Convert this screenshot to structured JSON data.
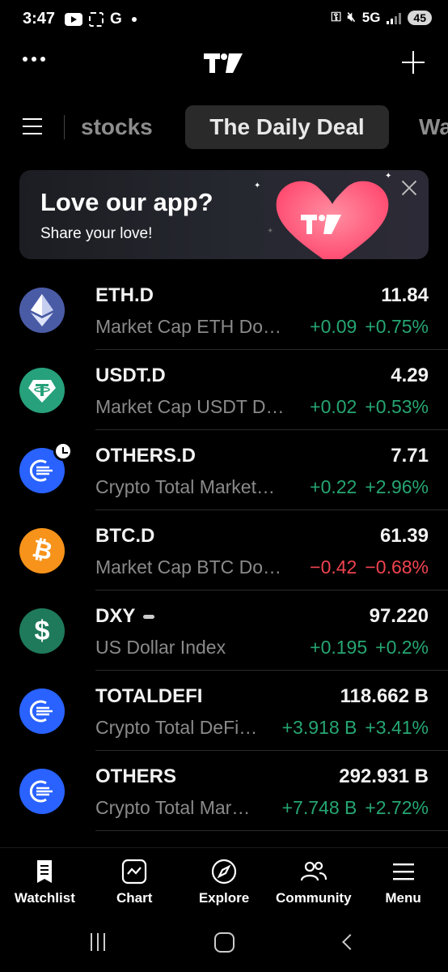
{
  "status_bar": {
    "time": "3:47",
    "g_label": "G",
    "network": "5G",
    "battery": "45"
  },
  "tabs": [
    {
      "label": "stocks"
    },
    {
      "label": "The Daily Deal"
    },
    {
      "label": "Wa"
    }
  ],
  "banner": {
    "title": "Love our app?",
    "subtitle": "Share your love!"
  },
  "watchlist": [
    {
      "symbol": "ETH.D",
      "description": "Market Cap ETH Do…",
      "price": "11.84",
      "change": "+0.09",
      "change_pct": "+0.75%",
      "direction": "up",
      "icon": "ethereum-icon",
      "icon_color": "#4a5ba6"
    },
    {
      "symbol": "USDT.D",
      "description": "Market Cap USDT D…",
      "price": "4.29",
      "change": "+0.02",
      "change_pct": "+0.53%",
      "direction": "up",
      "icon": "tether-icon",
      "icon_color": "#26a17b"
    },
    {
      "symbol": "OTHERS.D",
      "description": "Crypto Total Market…",
      "price": "7.71",
      "change": "+0.22",
      "change_pct": "+2.96%",
      "direction": "up",
      "icon": "crypto-index-icon",
      "icon_color": "#2962ff"
    },
    {
      "symbol": "BTC.D",
      "description": "Market Cap BTC Do…",
      "price": "61.39",
      "change": "−0.42",
      "change_pct": "−0.68%",
      "direction": "down",
      "icon": "bitcoin-icon",
      "icon_color": "#f7931a"
    },
    {
      "symbol": "DXY",
      "description": "US Dollar Index",
      "price": "97.220",
      "change": "+0.195",
      "change_pct": "+0.2%",
      "direction": "up",
      "icon": "dollar-icon",
      "icon_color": "#1e7a5a"
    },
    {
      "symbol": "TOTALDEFI",
      "description": "Crypto Total DeFi…",
      "price": "118.662 B",
      "change": "+3.918 B",
      "change_pct": "+3.41%",
      "direction": "up",
      "icon": "crypto-index-icon",
      "icon_color": "#2962ff"
    },
    {
      "symbol": "OTHERS",
      "description": "Crypto Total Mar…",
      "price": "292.931 B",
      "change": "+7.748 B",
      "change_pct": "+2.72%",
      "direction": "up",
      "icon": "crypto-index-icon",
      "icon_color": "#2962ff"
    }
  ],
  "bottom_nav": [
    {
      "label": "Watchlist",
      "icon": "watchlist-icon"
    },
    {
      "label": "Chart",
      "icon": "chart-icon"
    },
    {
      "label": "Explore",
      "icon": "compass-icon"
    },
    {
      "label": "Community",
      "icon": "community-icon"
    },
    {
      "label": "Menu",
      "icon": "menu-icon"
    }
  ],
  "colors": {
    "positive": "#26a672",
    "negative": "#f0434f",
    "background": "#000000"
  }
}
